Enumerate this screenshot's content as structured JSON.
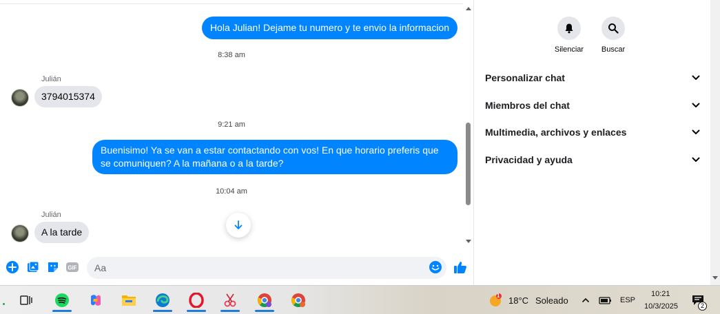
{
  "messages": {
    "outgoing_1": "Hola Julian! Dejame tu numero y te envio la informacion",
    "time_1": "8:38 am",
    "sender_1": "Julián",
    "incoming_1": "3794015374",
    "time_2": "9:21 am",
    "outgoing_2": "Buenisimo! Ya se van a estar contactando con vos! En que horario preferis que se comuniquen? A la mañana o a la tarde?",
    "time_3": "10:04 am",
    "sender_2": "Julián",
    "incoming_2": "A la tarde"
  },
  "composer": {
    "placeholder": "Aa",
    "icons": [
      "plus-icon",
      "image-icon",
      "sticker-icon",
      "gif-icon",
      "emoji-icon",
      "thumbs-up-icon"
    ],
    "gif_label": "GIF"
  },
  "info_panel": {
    "actions": [
      {
        "label": "Silenciar",
        "icon": "bell-icon"
      },
      {
        "label": "Buscar",
        "icon": "search-icon"
      }
    ],
    "sections": [
      {
        "label": "Personalizar chat"
      },
      {
        "label": "Miembros del chat"
      },
      {
        "label": "Multimedia, archivos y enlaces"
      },
      {
        "label": "Privacidad y ayuda"
      }
    ]
  },
  "taskbar": {
    "weather_temp": "18°C",
    "weather_desc": "Soleado",
    "weather_badge": "1",
    "language": "ESP",
    "time": "10:21",
    "date": "10/3/2025",
    "notifications": "2",
    "apps": [
      "task-view",
      "spotify",
      "copilot",
      "file-explorer",
      "edge",
      "opera",
      "snipping-tool",
      "chrome-profile",
      "chrome"
    ]
  },
  "colors": {
    "accent": "#0084ff",
    "incoming_bubble": "#e4e6eb",
    "composer_bg": "#f0f2f5"
  }
}
